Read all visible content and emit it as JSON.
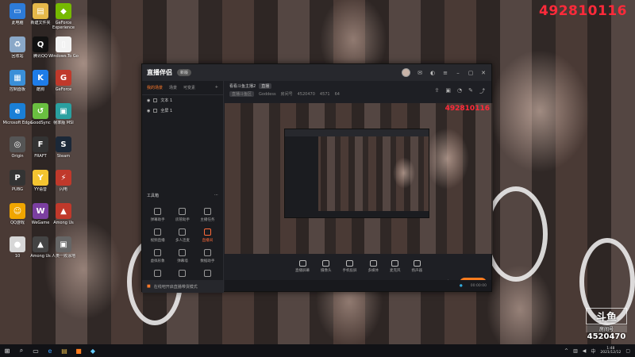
{
  "overlay": {
    "room_number": "492810116",
    "preview_room_number": "492810116"
  },
  "desktop_icons": [
    {
      "label": "此电脑",
      "color": "#2d7bd8",
      "glyph": "▭"
    },
    {
      "label": "新建文件夹",
      "color": "#e6b84a",
      "glyph": "▤"
    },
    {
      "label": "GeForce Experience",
      "color": "#76b900",
      "glyph": "◆"
    },
    {
      "label": "回收站",
      "color": "#8aa8c8",
      "glyph": "♻"
    },
    {
      "label": "腾讯QQ",
      "color": "#111",
      "glyph": "Q"
    },
    {
      "label": "Windows.To Go",
      "color": "#f2f2f2",
      "glyph": "▯"
    },
    {
      "label": "控制面板",
      "color": "#3a8fd8",
      "glyph": "▦"
    },
    {
      "label": "酷狗",
      "color": "#1e7ce8",
      "glyph": "K"
    },
    {
      "label": "GeForce",
      "color": "#c0392b",
      "glyph": "G"
    },
    {
      "label": "Microsoft Edge",
      "color": "#1a7fd6",
      "glyph": "e"
    },
    {
      "label": "GoodSync",
      "color": "#6abf40",
      "glyph": "↺"
    },
    {
      "label": "帧率版 MSI",
      "color": "#2aa0a0",
      "glyph": "▣"
    },
    {
      "label": "Origin",
      "color": "#555",
      "glyph": "◎"
    },
    {
      "label": "FRAFT",
      "color": "#333",
      "glyph": "F"
    },
    {
      "label": "Steam",
      "color": "#1b2838",
      "glyph": "S"
    },
    {
      "label": "PUBG",
      "color": "#333",
      "glyph": "P"
    },
    {
      "label": "YY语音",
      "color": "#f4c430",
      "glyph": "Y"
    },
    {
      "label": "闪电",
      "color": "#c0392b",
      "glyph": "⚡"
    },
    {
      "label": "QQ游戏",
      "color": "#f0a500",
      "glyph": "☺"
    },
    {
      "label": "WeGame",
      "color": "#7b3fa0",
      "glyph": "W"
    },
    {
      "label": "Among Us",
      "color": "#c0392b",
      "glyph": "▲"
    },
    {
      "label": "10",
      "color": "#d7d7d7",
      "glyph": "●"
    },
    {
      "label": "Among Us",
      "color": "#444",
      "glyph": "▲"
    },
    {
      "label": "人类一败涂地",
      "color": "#666",
      "glyph": "▣"
    }
  ],
  "app": {
    "logo": "直播伴侣",
    "badge": "新版",
    "left_tabs": [
      "我的场景",
      "场景",
      "可变素"
    ],
    "scenes": [
      "文本 1",
      "全屏 1"
    ],
    "tools_title": "工具箱",
    "tools": [
      {
        "label": "弹幕助手",
        "hot": false
      },
      {
        "label": "房管助手",
        "hot": false
      },
      {
        "label": "主播任务",
        "hot": false
      },
      {
        "label": "视频直播",
        "hot": false
      },
      {
        "label": "多人连麦",
        "hot": false
      },
      {
        "label": "直播间",
        "hot": true
      },
      {
        "label": "虚拟形象",
        "hot": false
      },
      {
        "label": "弹幕墙",
        "hot": false
      },
      {
        "label": "数据助手",
        "hot": false
      },
      {
        "label": "",
        "hot": false
      },
      {
        "label": "",
        "hot": false
      },
      {
        "label": "",
        "hot": false
      }
    ],
    "notice": "在线吧开启直播带货模式",
    "stream_title": "看看斗鱼主播2",
    "status_tag": "直播",
    "category_tag": "直播斗鱼区",
    "room_label": "房间号",
    "anchor": "Goddess",
    "room_id": "4520470",
    "fans": "4571",
    "viewers": "64",
    "controls": [
      "直播屏幕",
      "摄像头",
      "手机投屏",
      "多媒体",
      "麦克风",
      "扬声器"
    ],
    "start_button": "开始直播",
    "status_time": "00:00:00"
  },
  "douyu": {
    "logo": "斗鱼",
    "sub": "房间号",
    "number": "4520470"
  },
  "taskbar": {
    "time": "1:48",
    "date": "2021/12/12"
  }
}
